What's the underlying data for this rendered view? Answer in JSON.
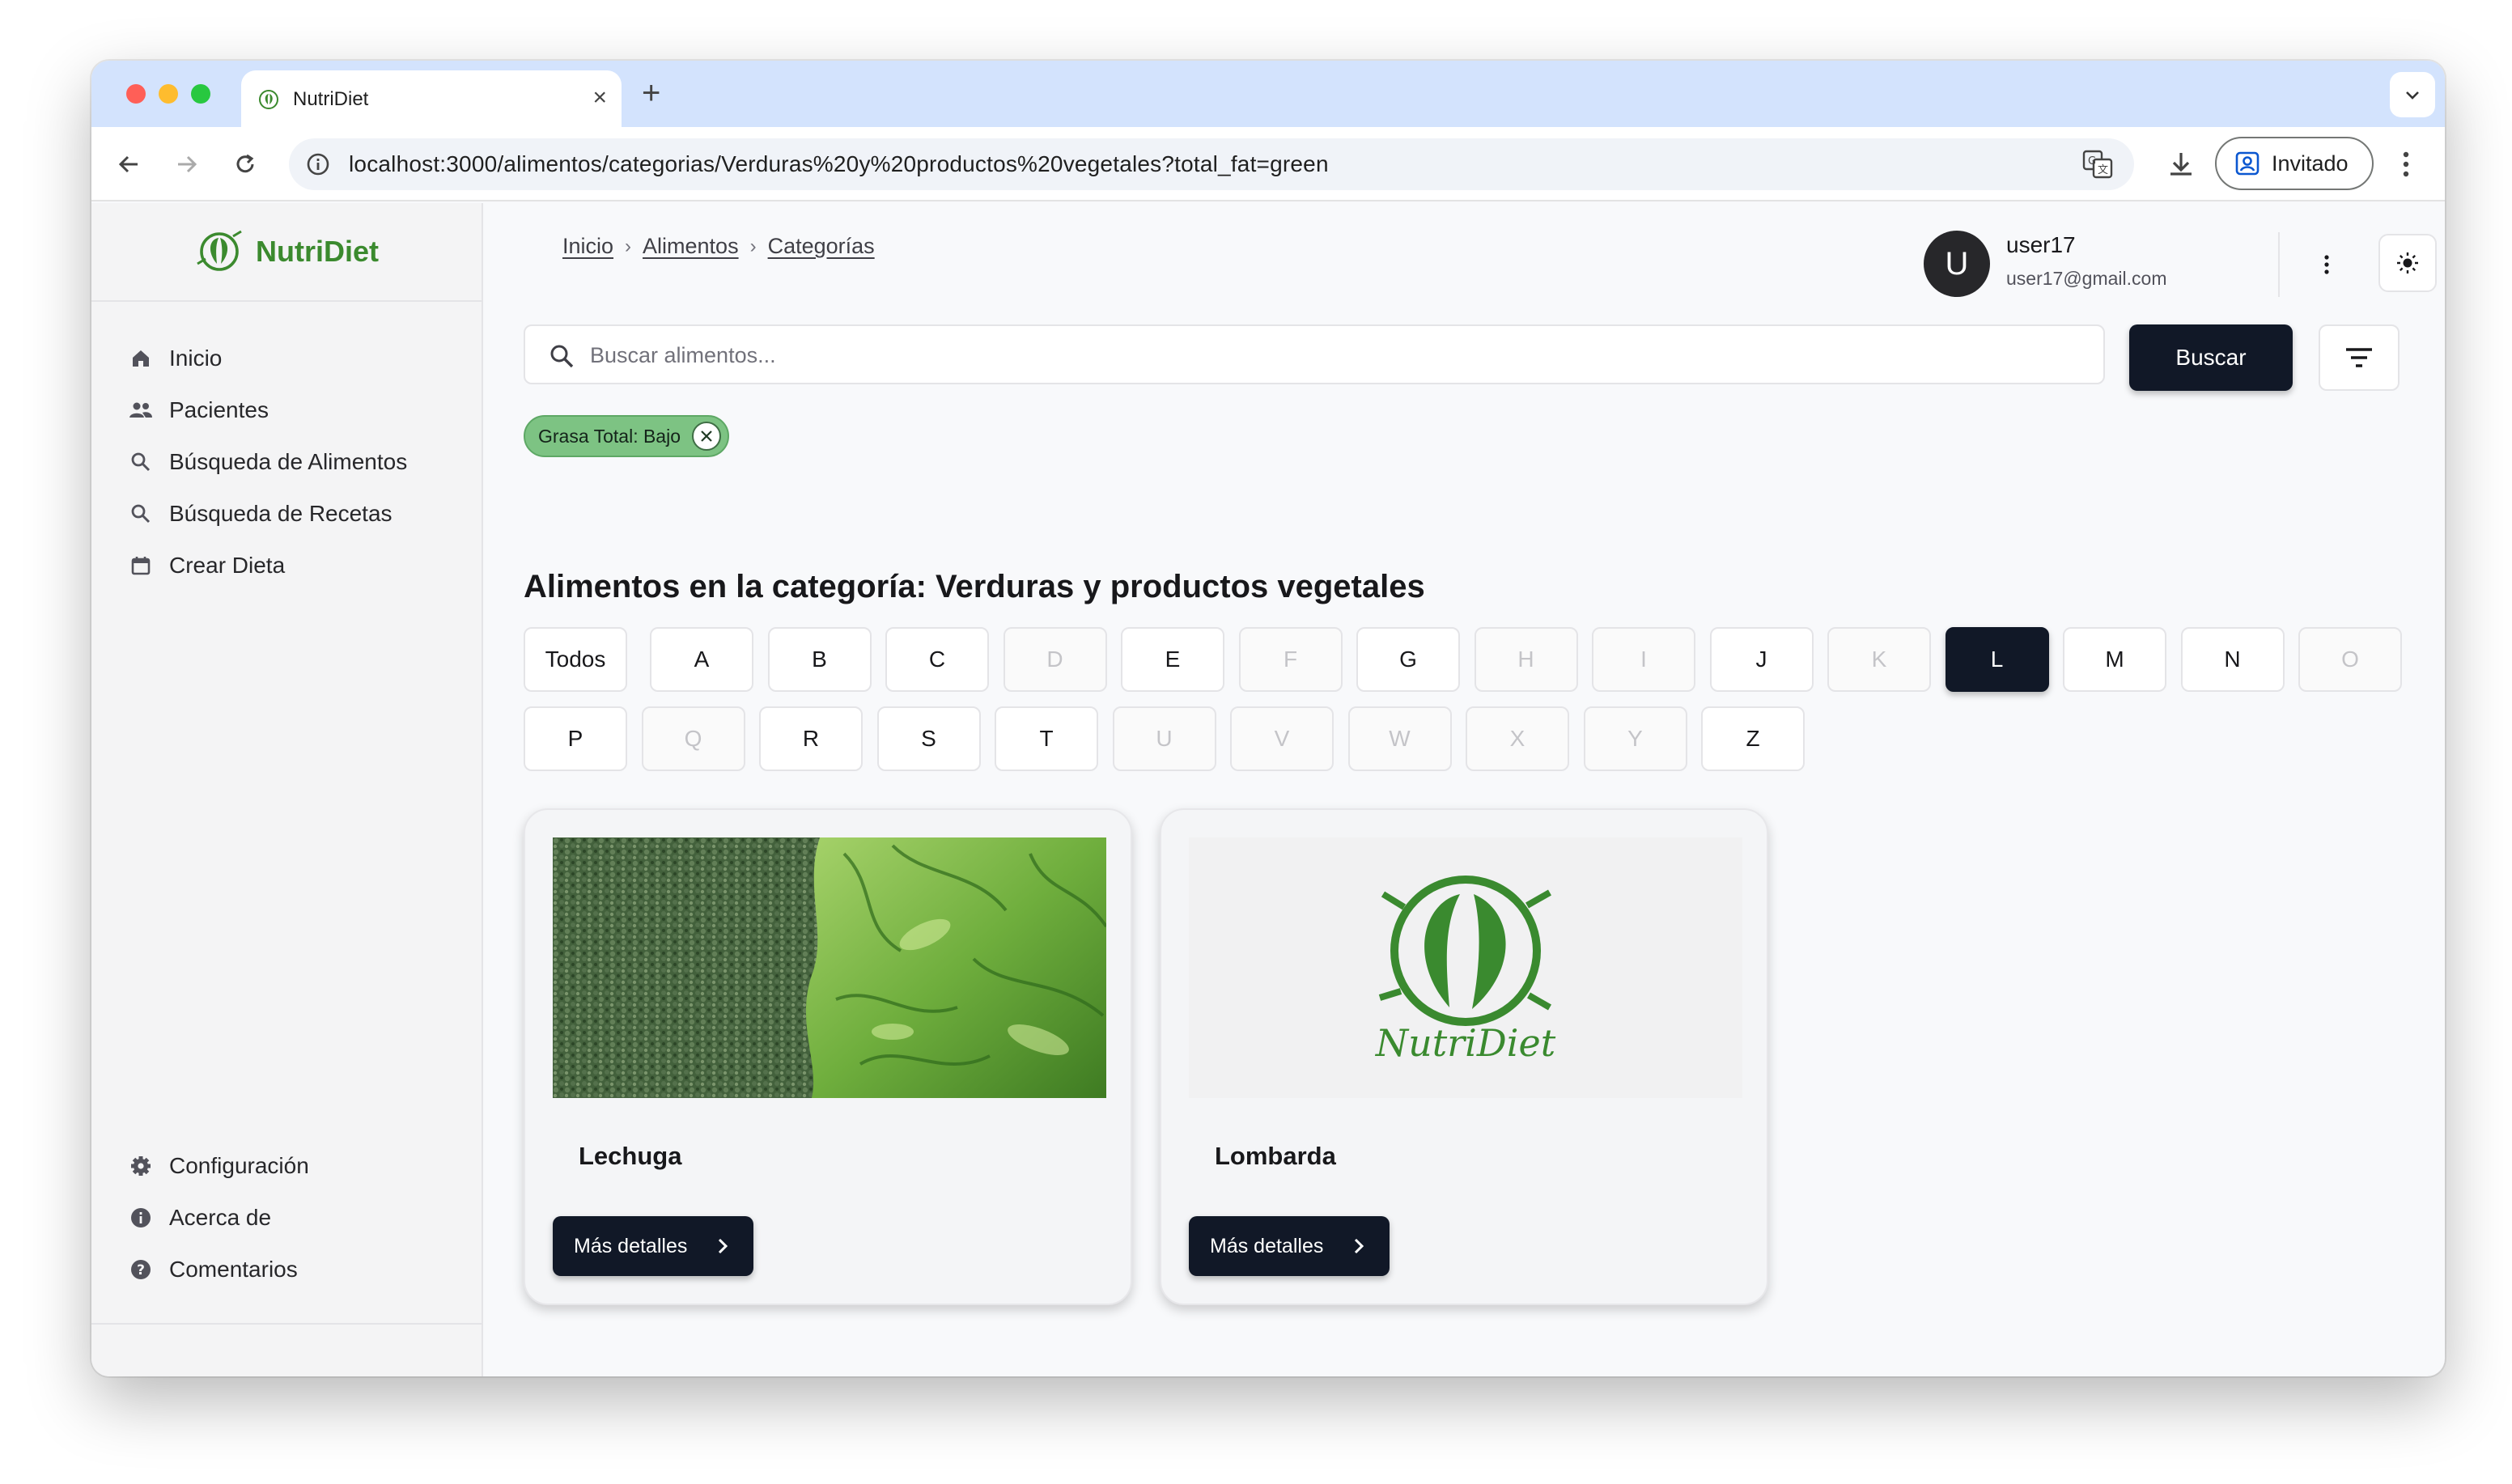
{
  "browser": {
    "tab_title": "NutriDiet",
    "url": "localhost:3000/alimentos/categorias/Verduras%20y%20productos%20vegetales?total_fat=green",
    "profile_label": "Invitado"
  },
  "sidebar": {
    "brand": "NutriDiet",
    "items": [
      {
        "label": "Inicio",
        "icon": "home-icon"
      },
      {
        "label": "Pacientes",
        "icon": "people-icon"
      },
      {
        "label": "Búsqueda de Alimentos",
        "icon": "search-icon"
      },
      {
        "label": "Búsqueda de Recetas",
        "icon": "search-icon"
      },
      {
        "label": "Crear Dieta",
        "icon": "calendar-icon"
      }
    ],
    "bottom_items": [
      {
        "label": "Configuración",
        "icon": "gear-icon"
      },
      {
        "label": "Acerca de",
        "icon": "info-icon"
      },
      {
        "label": "Comentarios",
        "icon": "help-icon"
      }
    ]
  },
  "header": {
    "breadcrumb": [
      "Inicio",
      "Alimentos",
      "Categorías"
    ],
    "user": {
      "initial": "U",
      "name": "user17",
      "email": "user17@gmail.com"
    }
  },
  "search": {
    "placeholder": "Buscar alimentos...",
    "value": "",
    "button_label": "Buscar"
  },
  "filter_chip": {
    "label": "Grasa Total: Bajo",
    "color": "#7dc383"
  },
  "category_title": "Alimentos en la categoría: Verduras y productos vegetales",
  "letters": {
    "all_label": "Todos",
    "active": "L",
    "row1": [
      "A",
      "B",
      "C",
      "D",
      "E",
      "F",
      "G",
      "H",
      "I",
      "J",
      "K",
      "L",
      "M",
      "N",
      "O"
    ],
    "row2": [
      "P",
      "Q",
      "R",
      "S",
      "T",
      "U",
      "V",
      "W",
      "X",
      "Y",
      "Z"
    ],
    "disabled": [
      "D",
      "F",
      "H",
      "I",
      "K",
      "O",
      "Q",
      "U",
      "V",
      "W",
      "X",
      "Y"
    ]
  },
  "foods": [
    {
      "name": "Lechuga",
      "button_label": "Más detalles",
      "image": "vegetables-photo"
    },
    {
      "name": "Lombarda",
      "button_label": "Más detalles",
      "image": "nutridiet-logo-placeholder",
      "logo_text": "NutriDiet"
    }
  ],
  "colors": {
    "brand_green": "#3b8a2e",
    "primary_dark": "#111827",
    "chrome_tabstrip": "#d3e3fd"
  }
}
